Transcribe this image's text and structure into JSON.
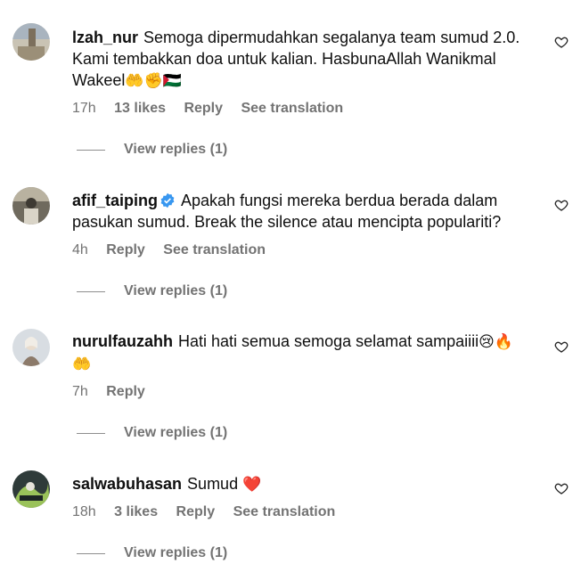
{
  "comments": [
    {
      "username": "lzah_nur",
      "text": "Semoga dipermudahkan segalanya team sumud 2.0. Kami tembakkan doa untuk kalian. HasbunaAllah Wanikmal Wakeel",
      "emoji": "🤲✊🇵🇸",
      "time": "17h",
      "likes": "13 likes",
      "reply": "Reply",
      "translation": "See translation",
      "view_replies": "View replies (1)"
    },
    {
      "username": "afif_taiping",
      "text": "Apakah fungsi mereka berdua berada dalam pasukan sumud. Break the silence atau mencipta populariti?",
      "time": "4h",
      "reply": "Reply",
      "translation": "See translation",
      "view_replies": "View replies (1)"
    },
    {
      "username": "nurulfauzahh",
      "text": "Hati hati semua semoga selamat sampaiiii",
      "emoji": "😢🔥",
      "emoji_line2": "🤲",
      "time": "7h",
      "reply": "Reply",
      "view_replies": "View replies (1)"
    },
    {
      "username": "salwabuhasan",
      "text": "Sumud",
      "emoji": "❤️",
      "time": "18h",
      "likes": "3 likes",
      "reply": "Reply",
      "translation": "See translation",
      "view_replies": "View replies (1)"
    }
  ],
  "colors": {
    "meta": "#737373",
    "heart": "#262626",
    "verified": "#3897f0",
    "heart_emoji": "#e0245e"
  },
  "icons": {
    "like": "heart-outline-icon",
    "verified": "verified-badge-icon"
  }
}
